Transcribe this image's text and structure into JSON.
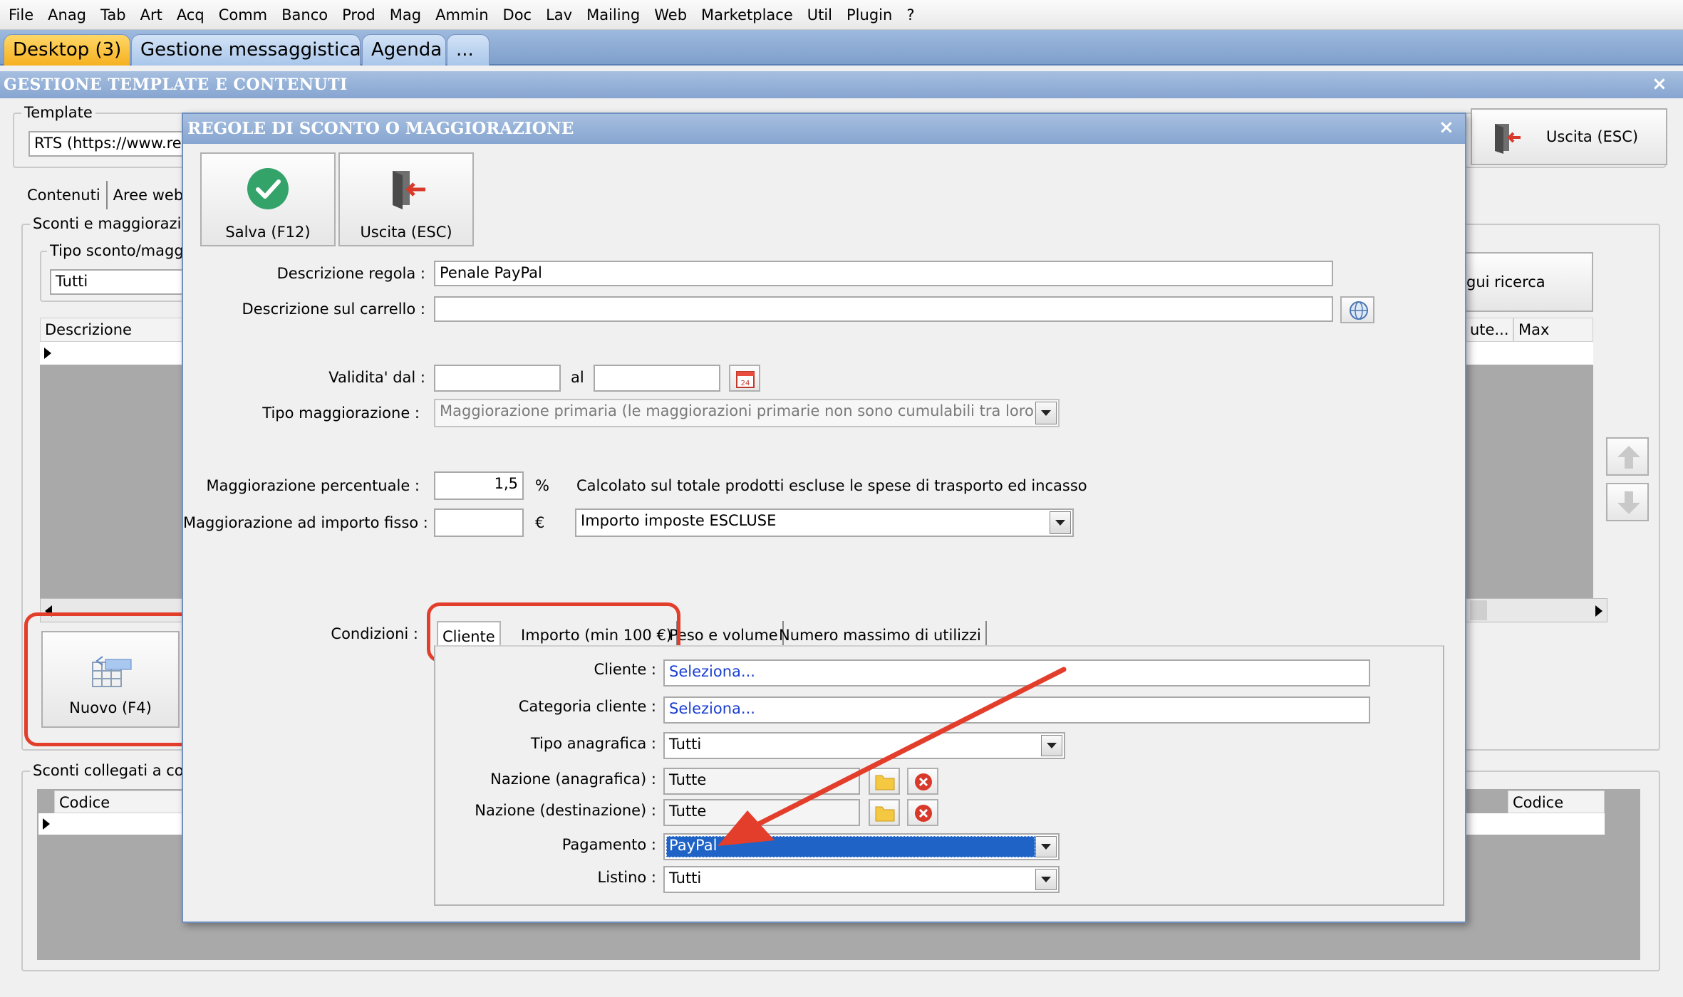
{
  "menu": [
    "File",
    "Anag",
    "Tab",
    "Art",
    "Acq",
    "Comm",
    "Banco",
    "Prod",
    "Mag",
    "Ammin",
    "Doc",
    "Lav",
    "Mailing",
    "Web",
    "Marketplace",
    "Util",
    "Plugin",
    "?"
  ],
  "tabs": {
    "desktop": "Desktop (3)",
    "messaggistica": "Gestione messaggistica",
    "agenda": "Agenda",
    "more": "..."
  },
  "main": {
    "title": "GESTIONE TEMPLATE E CONTENUTI",
    "template_label": "Template",
    "template_value": "RTS (https://www.rea",
    "uscita_button": "Uscita (ESC)",
    "subtabs": [
      "Contenuti",
      "Aree web"
    ],
    "sconti_group": "Sconti e maggiorazion",
    "tipo_group": "Tipo sconto/maggio",
    "tipo_value": "Tutti",
    "grid_col_descrizione": "Descrizione",
    "grid_col_ute": "ute...",
    "grid_col_max": "Max utilizzi",
    "search_button": "gui ricerca",
    "nuovo_button": "Nuovo (F4)",
    "collegati_group": "Sconti collegati a cond",
    "grid2_col_codice": "Codice",
    "grid2_col_codice_right": "Codice"
  },
  "dialog": {
    "title": "REGOLE DI SCONTO O MAGGIORAZIONE",
    "salva_button": "Salva (F12)",
    "uscita_button": "Uscita (ESC)",
    "descrizione_regola_label": "Descrizione regola :",
    "descrizione_regola_value": "Penale PayPal",
    "descrizione_carrello_label": "Descrizione sul carrello :",
    "descrizione_carrello_value": "",
    "validita_label": "Validita' dal :",
    "validita_dal": "",
    "al_label": "al",
    "validita_al": "",
    "tipo_magg_label": "Tipo maggiorazione :",
    "tipo_magg_value": "Maggiorazione primaria (le maggiorazioni primarie non sono cumulabili tra loro)",
    "magg_perc_label": "Maggiorazione percentuale :",
    "magg_perc_value": "1,5",
    "perc_unit": "%",
    "calcolato_note": "Calcolato sul totale prodotti escluse le spese di trasporto ed incasso",
    "magg_fisso_label": "Maggiorazione ad importo fisso :",
    "magg_fisso_value": "",
    "euro_unit": "€",
    "imposte_value": "Importo imposte ESCLUSE",
    "condizioni_label": "Condizioni :",
    "cond_tabs": [
      "Cliente",
      "Importo (min 100 €)",
      "Peso e volume",
      "Numero massimo di utilizzi"
    ],
    "cliente_label": "Cliente :",
    "cliente_value": "Seleziona...",
    "categoria_label": "Categoria cliente :",
    "categoria_value": "Seleziona...",
    "tipo_anag_label": "Tipo anagrafica :",
    "tipo_anag_value": "Tutti",
    "naz_anag_label": "Nazione (anagrafica) :",
    "naz_anag_value": "Tutte",
    "naz_dest_label": "Nazione (destinazione) :",
    "naz_dest_value": "Tutte",
    "pagamento_label": "Pagamento :",
    "pagamento_value": "PayPal",
    "listino_label": "Listino :",
    "listino_value": "Tutti"
  },
  "colors": {
    "annotation_red": "#e33e2b",
    "selection_blue": "#1f63c7",
    "title_blue": "#86a5d0"
  }
}
